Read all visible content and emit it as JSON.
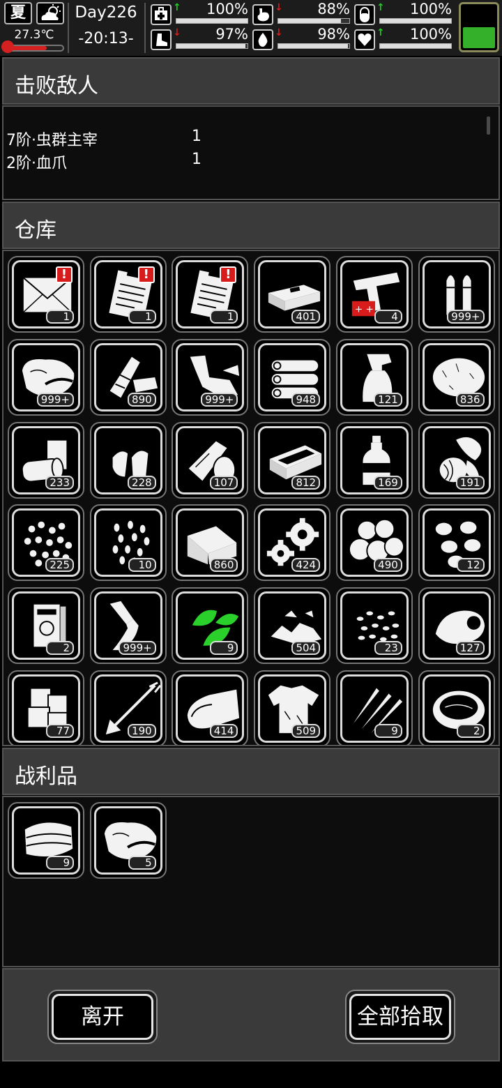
{
  "status": {
    "season": "夏",
    "weather_icon": "cloudy-sun-icon",
    "temperature": "27.3℃",
    "temperature_level": 0.72,
    "day": "Day226",
    "time": "-20:13-",
    "stats": [
      {
        "name": "health",
        "icon": "medkit-icon",
        "trend": "up",
        "value": "100%",
        "level": 1.0
      },
      {
        "name": "hunger",
        "icon": "stomach-icon",
        "trend": "down",
        "value": "88%",
        "level": 0.88
      },
      {
        "name": "sanity",
        "icon": "pill-icon",
        "trend": "up",
        "value": "100%",
        "level": 1.0
      },
      {
        "name": "stamina",
        "icon": "boot-icon",
        "trend": "down",
        "value": "97%",
        "level": 0.97
      },
      {
        "name": "thirst",
        "icon": "water-drop-icon",
        "trend": "down",
        "value": "98%",
        "level": 0.98
      },
      {
        "name": "mood",
        "icon": "heart-icon",
        "trend": "up",
        "value": "100%",
        "level": 1.0
      }
    ],
    "battery_level": 0.45
  },
  "enemies": {
    "title": "击败敌人",
    "rows": [
      {
        "name": "7阶·虫群主宰",
        "count": "1"
      },
      {
        "name": "2阶·血爪",
        "count": "1"
      }
    ]
  },
  "warehouse": {
    "title": "仓库",
    "items": [
      {
        "icon": "envelope-icon",
        "count": "1",
        "alert": "!"
      },
      {
        "icon": "clipboard-icon",
        "count": "1",
        "alert": "!"
      },
      {
        "icon": "clipboard-icon",
        "count": "1",
        "alert": "!"
      },
      {
        "icon": "cash-bundle-icon",
        "count": "401"
      },
      {
        "icon": "flare-gun-icon",
        "count": "4"
      },
      {
        "icon": "bullets-icon",
        "count": "999+"
      },
      {
        "icon": "meat-icon",
        "count": "999+"
      },
      {
        "icon": "trash-debris-icon",
        "count": "890"
      },
      {
        "icon": "scrap-pieces-icon",
        "count": "999+"
      },
      {
        "icon": "logs-icon",
        "count": "948"
      },
      {
        "icon": "spray-bottle-icon",
        "count": "121"
      },
      {
        "icon": "fur-ball-icon",
        "count": "836"
      },
      {
        "icon": "cans-icon",
        "count": "233"
      },
      {
        "icon": "ammo-shells-icon",
        "count": "228"
      },
      {
        "icon": "bandage-roll-icon",
        "count": "107"
      },
      {
        "icon": "crate-icon",
        "count": "812"
      },
      {
        "icon": "bottle-icon",
        "count": "169"
      },
      {
        "icon": "vegetables-icon",
        "count": "191"
      },
      {
        "icon": "pellets-icon",
        "count": "225"
      },
      {
        "icon": "seeds-icon",
        "count": "10"
      },
      {
        "icon": "cloth-icon",
        "count": "860"
      },
      {
        "icon": "gears-icon",
        "count": "424"
      },
      {
        "icon": "potatoes-icon",
        "count": "490"
      },
      {
        "icon": "beans-icon",
        "count": "12"
      },
      {
        "icon": "book-icon",
        "count": "2"
      },
      {
        "icon": "glue-tube-icon",
        "count": "999+"
      },
      {
        "icon": "herb-leaves-icon",
        "count": "9"
      },
      {
        "icon": "rubble-icon",
        "count": "504"
      },
      {
        "icon": "grain-icon",
        "count": "23"
      },
      {
        "icon": "organ-icon",
        "count": "127"
      },
      {
        "icon": "ice-cubes-icon",
        "count": "77"
      },
      {
        "icon": "arrow-icon",
        "count": "190"
      },
      {
        "icon": "fabric-roll-icon",
        "count": "414"
      },
      {
        "icon": "torn-shirt-icon",
        "count": "509"
      },
      {
        "icon": "claw-icon",
        "count": "9"
      },
      {
        "icon": "soup-bowl-icon",
        "count": "2"
      }
    ]
  },
  "loot": {
    "title": "战利品",
    "items": [
      {
        "icon": "cloth-stack-icon",
        "count": "9"
      },
      {
        "icon": "meat-icon",
        "count": "5"
      }
    ]
  },
  "actions": {
    "leave": "离开",
    "take_all": "全部拾取"
  },
  "colors": {
    "up_arrow": "#19d11b",
    "down_arrow": "#e01818",
    "herb": "#2bd12b",
    "battery": "#35b02a",
    "alert": "#d81b1b"
  }
}
